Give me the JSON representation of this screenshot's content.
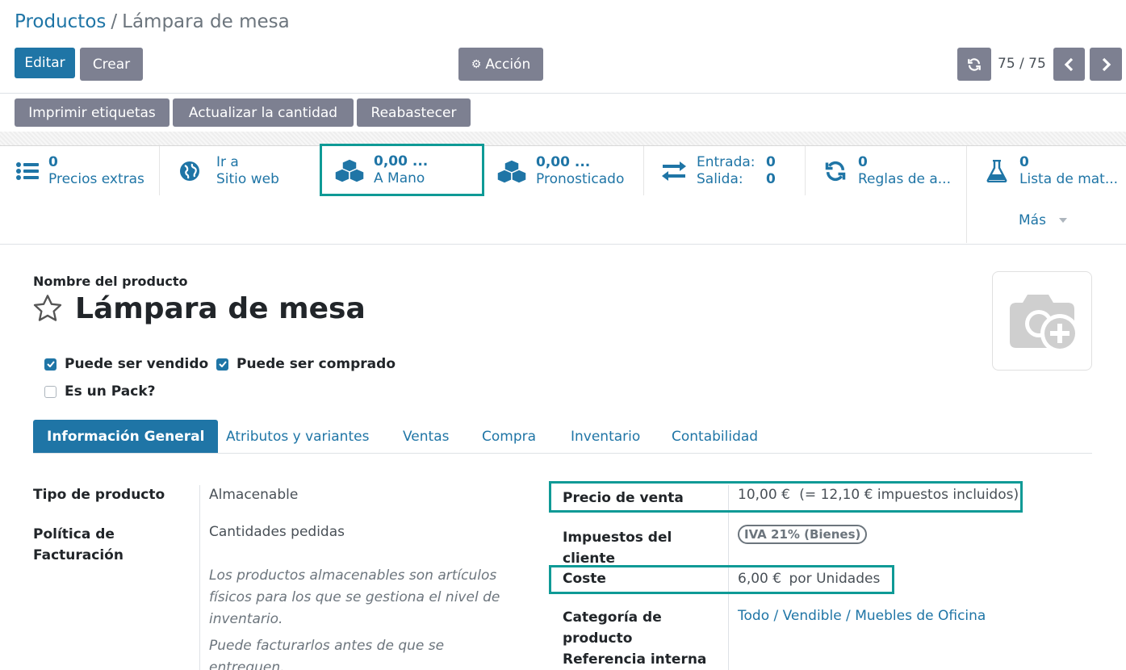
{
  "breadcrumb": {
    "parent": "Productos",
    "separator": "/",
    "current": "Lámpara de mesa"
  },
  "toolbar": {
    "edit_label": "Editar",
    "create_label": "Crear",
    "action_label": "Acción",
    "pager_text": "75 / 75",
    "print_labels": "Imprimir etiquetas",
    "update_qty": "Actualizar la cantidad",
    "replenish": "Reabastecer"
  },
  "stat_buttons": {
    "extra_prices": {
      "value": "0",
      "label": "Precios extras"
    },
    "website": {
      "line1": "Ir a",
      "line2": "Sitio web"
    },
    "on_hand": {
      "value": "0,00 ...",
      "label": "A Mano"
    },
    "forecast": {
      "value": "0,00 ...",
      "label": "Pronosticado"
    },
    "moves": {
      "in_label": "Entrada:",
      "in_value": "0",
      "out_label": "Salida:",
      "out_value": "0"
    },
    "reorder": {
      "value": "0",
      "label": "Reglas de a..."
    },
    "bom": {
      "value": "0",
      "label": "Lista de mat..."
    },
    "more": "Más"
  },
  "form": {
    "name_label": "Nombre del producto",
    "name": "Lámpara de mesa",
    "can_be_sold": "Puede ser vendido",
    "can_be_purchased": "Puede ser comprado",
    "is_pack": "Es un Pack?"
  },
  "tabs": [
    "Información General",
    "Atributos y variantes",
    "Ventas",
    "Compra",
    "Inventario",
    "Contabilidad"
  ],
  "general": {
    "type_label": "Tipo de producto",
    "type_value": "Almacenable",
    "invoice_policy_label_1": "Política de",
    "invoice_policy_label_2": "Facturación",
    "invoice_policy_value": "Cantidades pedidas",
    "note_1": "Los productos almacenables son artículos",
    "note_2": "físicos para los que se gestiona el nivel de",
    "note_3": "inventario.",
    "note_4": "Puede facturarlos antes de que se",
    "note_5": "entreguen.",
    "sale_price_label": "Precio de venta",
    "sale_price_value": "10,00 €",
    "sale_price_taxed": "(= 12,10 € impuestos incluidos)",
    "taxes_label_1": "Impuestos del",
    "taxes_label_2": "cliente",
    "tax_tag": "IVA 21% (Bienes)",
    "cost_label": "Coste",
    "cost_value": "6,00 €",
    "cost_uom": "por Unidades",
    "category_label_1": "Categoría de",
    "category_label_2": "producto",
    "category_path": "Todo / Vendible / Muebles de Oficina",
    "internal_ref_label": "Referencia interna"
  },
  "colors": {
    "primary": "#1f75a6",
    "secondary": "#7d8091",
    "highlight": "#0f9a96"
  }
}
